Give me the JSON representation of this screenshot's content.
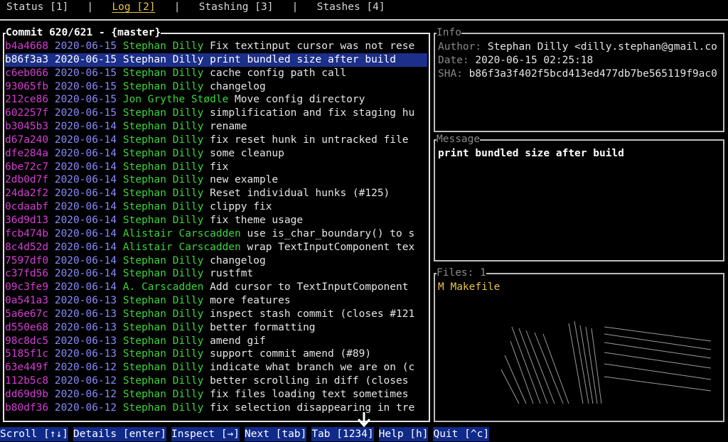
{
  "tabs": [
    {
      "label": "Status [1]",
      "active": false
    },
    {
      "label": "Log [2]",
      "active": true
    },
    {
      "label": "Stashing [3]",
      "active": false
    },
    {
      "label": "Stashes [4]",
      "active": false
    }
  ],
  "tab_separator": "|",
  "log_panel": {
    "title": "Commit 620/621 - {master}",
    "selected_index": 1,
    "commits": [
      {
        "hash": "b4a4668",
        "date": "2020-06-15",
        "author": "Stephan Dilly",
        "msg": "Fix textinput cursor was not rese"
      },
      {
        "hash": "b86f3a3",
        "date": "2020-06-15",
        "author": "Stephan Dilly",
        "msg": "print bundled size after build"
      },
      {
        "hash": "c6eb066",
        "date": "2020-06-15",
        "author": "Stephan Dilly",
        "msg": "cache config path call"
      },
      {
        "hash": "93065fb",
        "date": "2020-06-15",
        "author": "Stephan Dilly",
        "msg": "changelog"
      },
      {
        "hash": "212ce86",
        "date": "2020-06-15",
        "author": "Jon Grythe Stødle",
        "msg": "Move config directory"
      },
      {
        "hash": "602257f",
        "date": "2020-06-15",
        "author": "Stephan Dilly",
        "msg": "simplification and fix staging hu"
      },
      {
        "hash": "b3045b3",
        "date": "2020-06-14",
        "author": "Stephan Dilly",
        "msg": "rename"
      },
      {
        "hash": "d67a240",
        "date": "2020-06-14",
        "author": "Stephan Dilly",
        "msg": "fix reset hunk in untracked file"
      },
      {
        "hash": "dfe284a",
        "date": "2020-06-14",
        "author": "Stephan Dilly",
        "msg": "some cleanup"
      },
      {
        "hash": "6be72c7",
        "date": "2020-06-14",
        "author": "Stephan Dilly",
        "msg": "fix"
      },
      {
        "hash": "2db0d7f",
        "date": "2020-06-14",
        "author": "Stephan Dilly",
        "msg": "new example"
      },
      {
        "hash": "24da2f2",
        "date": "2020-06-14",
        "author": "Stephan Dilly",
        "msg": "Reset individual hunks (#125)"
      },
      {
        "hash": "0cdaabf",
        "date": "2020-06-14",
        "author": "Stephan Dilly",
        "msg": "clippy fix"
      },
      {
        "hash": "36d9d13",
        "date": "2020-06-14",
        "author": "Stephan Dilly",
        "msg": "fix theme usage"
      },
      {
        "hash": "fcb474b",
        "date": "2020-06-14",
        "author": "Alistair Carscadden",
        "msg": "use is_char_boundary() to s"
      },
      {
        "hash": "8c4d52d",
        "date": "2020-06-14",
        "author": "Alistair Carscadden",
        "msg": "wrap TextInputComponent tex"
      },
      {
        "hash": "7597df0",
        "date": "2020-06-14",
        "author": "Stephan Dilly",
        "msg": "changelog"
      },
      {
        "hash": "c37fd56",
        "date": "2020-06-14",
        "author": "Stephan Dilly",
        "msg": "rustfmt"
      },
      {
        "hash": "09c3fe9",
        "date": "2020-06-14",
        "author": "A. Carscadden",
        "msg": "Add cursor to TextInputComponent"
      },
      {
        "hash": "0a541a3",
        "date": "2020-06-13",
        "author": "Stephan Dilly",
        "msg": "more features"
      },
      {
        "hash": "5a6e67c",
        "date": "2020-06-13",
        "author": "Stephan Dilly",
        "msg": "inspect stash commit (closes #121"
      },
      {
        "hash": "d550e68",
        "date": "2020-06-13",
        "author": "Stephan Dilly",
        "msg": "better formatting"
      },
      {
        "hash": "98c8dc5",
        "date": "2020-06-13",
        "author": "Stephan Dilly",
        "msg": "amend gif"
      },
      {
        "hash": "5185f1c",
        "date": "2020-06-13",
        "author": "Stephan Dilly",
        "msg": "support commit amend (#89)"
      },
      {
        "hash": "63e449f",
        "date": "2020-06-12",
        "author": "Stephan Dilly",
        "msg": "indicate what branch we are on (c"
      },
      {
        "hash": "112b5c8",
        "date": "2020-06-12",
        "author": "Stephan Dilly",
        "msg": "better scrolling in diff (closes"
      },
      {
        "hash": "dd69d9b",
        "date": "2020-06-12",
        "author": "Stephan Dilly",
        "msg": "fix files loading text sometimes"
      },
      {
        "hash": "b80df36",
        "date": "2020-06-12",
        "author": "Stephan Dilly",
        "msg": "fix selection disappearing in tre"
      }
    ]
  },
  "info_panel": {
    "title": "Info",
    "author_label": "Author:",
    "author_value": "Stephan Dilly <dilly.stephan@gmail.co",
    "date_label": "Date:",
    "date_value": "2020-06-15 02:25:18",
    "sha_label": "SHA:",
    "sha_value": "b86f3a3f402f5bcd413ed477db7be565119f9ac0"
  },
  "message_panel": {
    "title": "Message",
    "text": "print bundled size after build"
  },
  "files_panel": {
    "title": "Files: 1",
    "files": [
      {
        "status": "M",
        "name": "Makefile"
      }
    ]
  },
  "command_bar": [
    {
      "label": "Scroll [↑↓]",
      "enabled": true
    },
    {
      "label": "Details [enter]",
      "enabled": true
    },
    {
      "label": "Inspect [→]",
      "enabled": true
    },
    {
      "label": "Next [tab]",
      "enabled": true
    },
    {
      "label": "Tab [1234]",
      "enabled": true
    },
    {
      "label": "Help [h]",
      "enabled": true
    },
    {
      "label": "Quit [^c]",
      "enabled": true
    }
  ],
  "colors": {
    "hash": "#d63cd6",
    "date": "#8a8aff",
    "author": "#3ad63a",
    "selection": "#1c2f8a",
    "active_tab": "#e8c547",
    "command_bg": "#102a8a"
  }
}
